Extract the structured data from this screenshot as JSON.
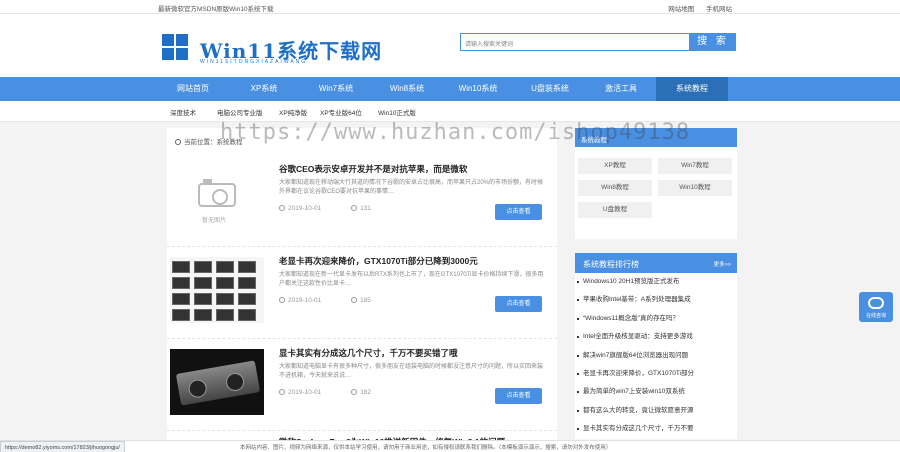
{
  "topbar": {
    "notice": "最新微软官方MSDN原版Win10系统下载",
    "links": [
      "网站地图",
      "手机网站"
    ]
  },
  "logo": {
    "title": "Win11系统下载网",
    "subtitle": "WIN11SITONGXIAZAIWANG"
  },
  "search": {
    "placeholder": "请输入搜索关键词",
    "button": "搜 索"
  },
  "nav": [
    "网站首页",
    "XP系统",
    "Win7系统",
    "Win8系统",
    "Win10系统",
    "U盘装系统",
    "激活工具",
    "系统教程"
  ],
  "subnav": [
    "深度技术",
    "电脑公司专业版",
    "XP纯净版",
    "XP专业版64位",
    "Win10正式版"
  ],
  "breadcrumb": {
    "label": "当前位置：",
    "path": "系统教程"
  },
  "watermark": "https://www.huzhan.com/ishop49138",
  "articles": [
    {
      "title": "谷歌CEO表示安卓开发并不是对抗苹果，而是微软",
      "summary": "大家都知道现在移动端大行其道的情况下谷歌的安卓占比很高，而苹果只占20%的市场份额，有时候外界都在议论谷歌CEO要对抗苹果的事情…",
      "date": "2019-10-01",
      "views": "131",
      "button": "点击查看",
      "thumb_caption": "暂无图片"
    },
    {
      "title": "老显卡再次迎来降价，GTX1070Ti部分已降到3000元",
      "summary": "大家都知道现在新一代显卡发布以后RTX系列也上市了，现在GTX1070Ti显卡价格持续下滑，很多用户都关注这款性价比显卡…",
      "date": "2019-10-01",
      "views": "185",
      "button": "点击查看"
    },
    {
      "title": "显卡其实有分成这几个尺寸，千万不要买错了哦",
      "summary": "大家都知道电脑显卡有很多种尺寸，很多朋友在组装电脑的时候都没注意尺寸的问题，所以买回来装不进机箱，今天就来说说…",
      "date": "2019-10-01",
      "views": "182",
      "button": "点击查看"
    },
    {
      "title": "微软Surface Pro 3为Win10推送新固件，修复Win8.1的问题",
      "summary": "",
      "date": "",
      "views": "",
      "button": ""
    }
  ],
  "sidebar": {
    "tags_title": "系统教程",
    "tags": [
      "XP教程",
      "Win7教程",
      "Win8教程",
      "Win10教程",
      "U盘教程"
    ],
    "rank_title": "系统教程排行榜",
    "rank_more": "更多>>",
    "rank": [
      "Windows10 20H1预览版正式发布",
      "苹果收购Intel基带：A系列处理器集成",
      "“Windows11概念版”真的存在吗？",
      "Intel全面升级核显驱动：支持更多游戏",
      "解决win7旗舰版64位浏览器出现问题",
      "老显卡再次迎来降价，GTX1070Ti部分",
      "最为简单的win7上安装win10双系统",
      "都有这么大的转变，竟让微软愿意开源",
      "显卡其实有分成这几个尺寸，千万不要"
    ]
  },
  "float_button": {
    "label": "在线咨询"
  },
  "footer": {
    "status_url": "https://demo82.yiyoms.com/17823/jihuogongju/",
    "copyright": "本网站内容、图片、视频为网络来源，仅供本站学习使用，请勿用于商业用途，如有侵权请联系我们删除。（本模板演示演示，搜索，请勿对外发布使用）"
  }
}
